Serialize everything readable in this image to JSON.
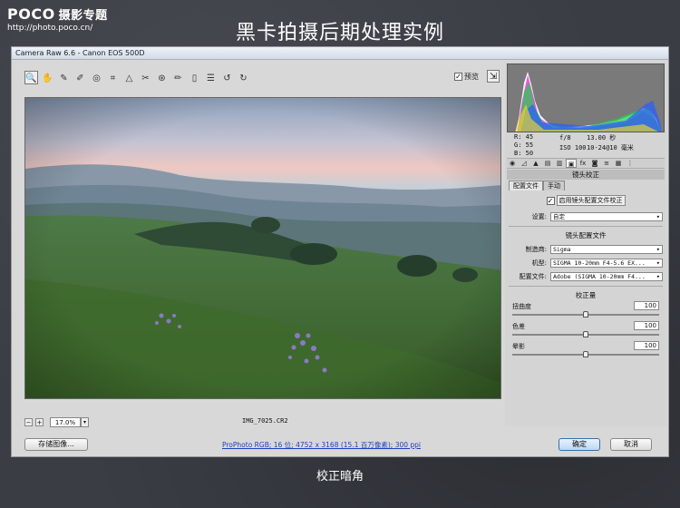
{
  "brand": {
    "logo": "POCO",
    "channel": "摄影专题",
    "url": "http://photo.poco.cn/"
  },
  "page_title": "黑卡拍摄后期处理实例",
  "caption": "校正暗角",
  "window": {
    "title": "Camera Raw 6.6 -  Canon EOS 500D"
  },
  "toolbar": {
    "tools": [
      "zoom-tool-icon",
      "hand-tool-icon",
      "white-balance-icon",
      "color-sampler-icon",
      "target-adjust-icon",
      "crop-icon",
      "straighten-icon",
      "spot-removal-icon",
      "red-eye-icon",
      "adjustment-brush-icon",
      "graduated-filter-icon",
      "preferences-icon",
      "rotate-ccw-icon",
      "rotate-cw-icon"
    ],
    "preview_label": "预览"
  },
  "statusbar": {
    "zoom": "17.0%",
    "filename": "IMG_7025.CR2"
  },
  "buttons": {
    "save": "存储图像...",
    "ok": "确定",
    "cancel": "取消"
  },
  "workflow_link": "ProPhoto RGB; 16 位; 4752 x 3168 (15.1 百万像素); 300 ppi",
  "readout": {
    "r": "R:   45",
    "g": "G:   55",
    "b": "B:   50",
    "aperture": "f/8",
    "shutter": "13.00 秒",
    "iso": "ISO 100",
    "lens": "10-24@10 毫米"
  },
  "panel": {
    "header": "镜头校正",
    "subtabs": [
      "配置文件",
      "手动"
    ],
    "enable_profile": "启用镜头配置文件校正",
    "settings_label": "设置:",
    "settings_value": "自定",
    "profile_section": "镜头配置文件",
    "make_label": "制造商:",
    "make_value": "Sigma",
    "model_label": "机型:",
    "model_value": "SIGMA 10-20mm F4-5.6 EX...",
    "profile_label": "配置文件:",
    "profile_value": "Adobe (SIGMA 10-20mm F4...",
    "amount_section": "校正量",
    "sliders": [
      {
        "label": "扭曲度",
        "value": "100",
        "level": 0.5
      },
      {
        "label": "色差",
        "value": "100",
        "level": 0.5
      },
      {
        "label": "晕影",
        "value": "100",
        "level": 0.5
      }
    ]
  }
}
